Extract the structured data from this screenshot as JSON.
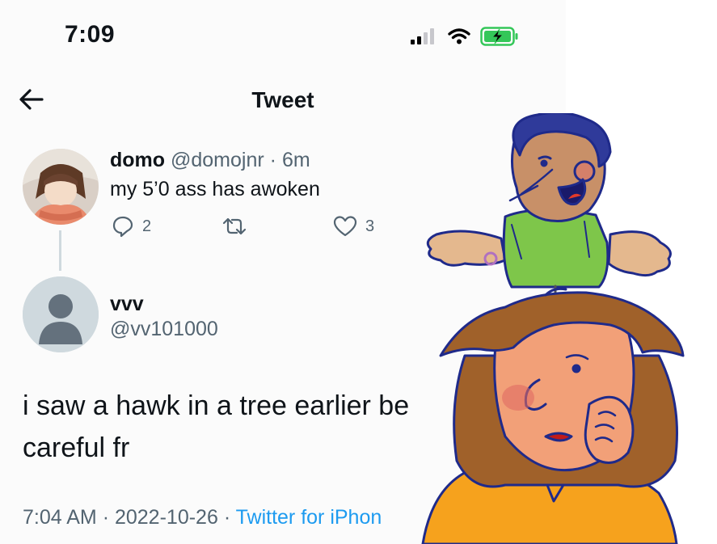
{
  "status_bar": {
    "time": "7:09",
    "icons": [
      "cellular-signal-icon",
      "wifi-icon",
      "battery-charging-icon"
    ],
    "battery_color": "#34c759"
  },
  "header": {
    "back_icon": "arrow-left-icon",
    "title": "Tweet"
  },
  "original_tweet": {
    "name": "domo",
    "handle": "@domojnr",
    "separator": "·",
    "time": "6m",
    "text": "my 5’0 ass has awoken",
    "actions": {
      "reply_count": "2",
      "retweet_count": "",
      "like_count": "3"
    }
  },
  "reply_tweet": {
    "name": "vvv",
    "handle": "@vv101000",
    "text": "i saw a hawk in a tree earlier  be careful fr",
    "timestamp": "7:04 AM",
    "date": "2022-10-26",
    "separator": "·",
    "source": "Twitter for iPhon"
  },
  "colors": {
    "text_primary": "#0f1419",
    "text_secondary": "#536471",
    "link": "#1d9bf0",
    "thread_line": "#cfd9de"
  }
}
